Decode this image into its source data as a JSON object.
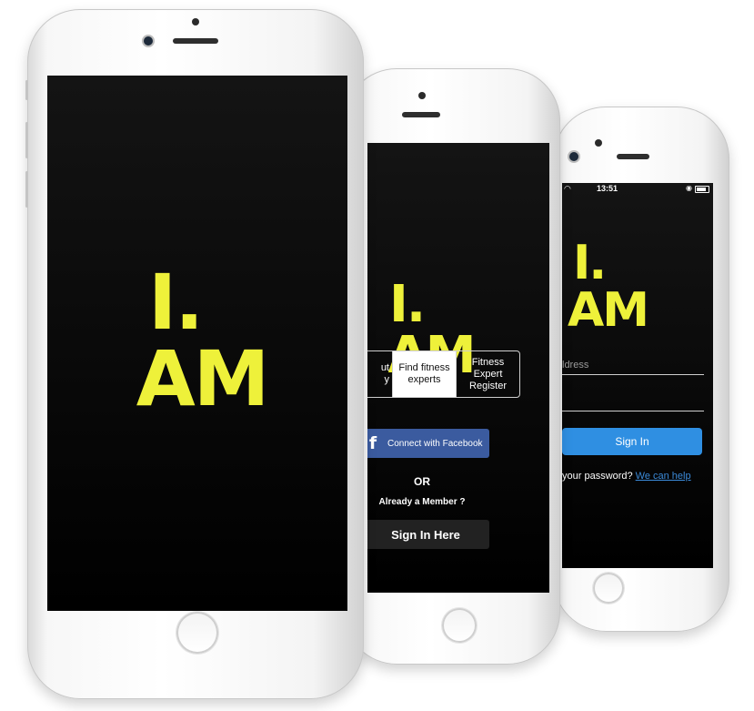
{
  "brand": {
    "logo_line1": "I.",
    "logo_line2": "AM",
    "accent_color": "#eef13a"
  },
  "splash_screen": {
    "logo_line1": "I.",
    "logo_line2": "AM"
  },
  "welcome_screen": {
    "logo_line1": "I.",
    "logo_line2": "AM",
    "segments": [
      {
        "label": "ut\ny",
        "active": false
      },
      {
        "label": "Find fitness experts",
        "active": true
      },
      {
        "label": "Fitness Expert Register",
        "active": false
      }
    ],
    "facebook_icon": "facebook-f-icon",
    "facebook_label": "Connect with Facebook",
    "facebook_color": "#3b5b9f",
    "or_label": "OR",
    "member_prompt": "Already a Member ?",
    "signin_here_label": "Sign In Here"
  },
  "login_screen": {
    "status_time": "13:51",
    "logo_line1": "I.",
    "logo_line2": "AM",
    "email_placeholder": "ldress",
    "password_placeholder": "",
    "signin_label": "Sign In",
    "signin_color": "#2f8fe2",
    "forgot_text": "your password?",
    "help_link": "We can help"
  }
}
